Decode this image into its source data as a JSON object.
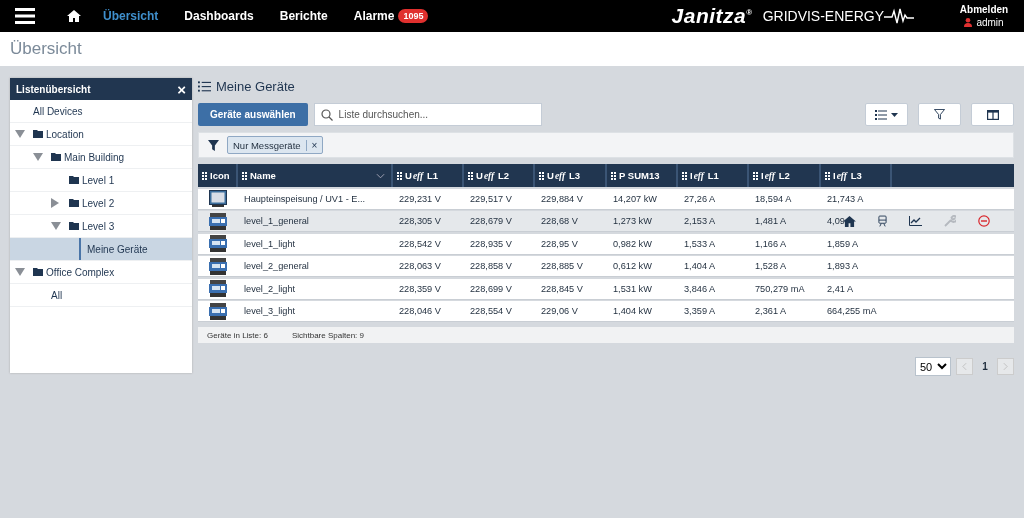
{
  "nav": {
    "tabs": [
      {
        "label": "Übersicht",
        "selected": true
      },
      {
        "label": "Dashboards",
        "selected": false
      },
      {
        "label": "Berichte",
        "selected": false
      },
      {
        "label": "Alarme",
        "selected": false,
        "badge": "1095"
      }
    ],
    "logo": "Janitza",
    "logo_mark": "®",
    "product": "GRIDVIS-ENERGY",
    "logout": "Abmelden",
    "user": "admin"
  },
  "page_title": "Übersicht",
  "sidebar": {
    "title": "Listenübersicht",
    "close": "×",
    "items": [
      {
        "label": "All Devices",
        "kind": "list",
        "selected": false
      },
      {
        "label": "Location",
        "kind": "folder",
        "expanded": true,
        "selected": false,
        "children": [
          {
            "label": "Main Building",
            "kind": "folder",
            "expanded": true,
            "selected": false,
            "children": [
              {
                "label": "Level 1",
                "kind": "folder",
                "selected": false
              },
              {
                "label": "Level 2",
                "kind": "folder",
                "expanded": false,
                "selected": false
              },
              {
                "label": "Level 3",
                "kind": "folder",
                "expanded": true,
                "selected": false,
                "children": [
                  {
                    "label": "Meine Geräte",
                    "kind": "list",
                    "selected": true
                  }
                ]
              }
            ]
          }
        ]
      },
      {
        "label": "Office Complex",
        "kind": "folder",
        "expanded": true,
        "selected": false,
        "children": [
          {
            "label": "All",
            "kind": "list",
            "selected": false
          }
        ]
      }
    ]
  },
  "main": {
    "title": "Meine Geräte",
    "select_button": "Geräte auswählen",
    "search": {
      "placeholder": "Liste durchsuchen..."
    },
    "filter_tag": {
      "label": "Nur Messgeräte",
      "remove": "×"
    },
    "table": {
      "icon_header": "Icon",
      "columns": [
        {
          "prefix": "Name"
        },
        {
          "prefix": "U",
          "italic": "eff",
          "suffix": " L1"
        },
        {
          "prefix": "U",
          "italic": "eff",
          "suffix": " L2"
        },
        {
          "prefix": "U",
          "italic": "eff",
          "suffix": " L3"
        },
        {
          "prefix": "P SUM13"
        },
        {
          "prefix": "I",
          "italic": "eff",
          "suffix": " L1"
        },
        {
          "prefix": "I",
          "italic": "eff",
          "suffix": " L2"
        },
        {
          "prefix": "I",
          "italic": "eff",
          "suffix": " L3"
        }
      ],
      "rows": [
        {
          "kind": "display",
          "hovered": false,
          "cells": [
            "Haupteinspeisung / UV1 - E...",
            "229,231 V",
            "229,517 V",
            "229,884 V",
            "14,207 kW",
            "27,26 A",
            "18,594 A",
            "21,743 A"
          ]
        },
        {
          "kind": "module",
          "hovered": true,
          "cells": [
            "level_1_general",
            "228,305 V",
            "228,679 V",
            "228,68 V",
            "1,273 kW",
            "2,153 A",
            "1,481 A",
            "4,09"
          ]
        },
        {
          "kind": "module",
          "hovered": false,
          "cells": [
            "level_1_light",
            "228,542 V",
            "228,935 V",
            "228,95 V",
            "0,982 kW",
            "1,533 A",
            "1,166 A",
            "1,859 A"
          ]
        },
        {
          "kind": "module",
          "hovered": false,
          "cells": [
            "level_2_general",
            "228,063 V",
            "228,858 V",
            "228,885 V",
            "0,612 kW",
            "1,404 A",
            "1,528 A",
            "1,893 A"
          ]
        },
        {
          "kind": "module",
          "hovered": false,
          "cells": [
            "level_2_light",
            "228,359 V",
            "228,699 V",
            "228,845 V",
            "1,531 kW",
            "3,846 A",
            "750,279 mA",
            "2,41 A"
          ]
        },
        {
          "kind": "module",
          "hovered": false,
          "cells": [
            "level_3_light",
            "228,046 V",
            "228,554 V",
            "229,06 V",
            "1,404 kW",
            "3,359 A",
            "2,361 A",
            "664,255 mA"
          ]
        }
      ]
    },
    "footer": [
      {
        "label": "Geräte in Liste:",
        "value": "6"
      },
      {
        "label": "Sichtbare Spalten:",
        "value": "9"
      }
    ],
    "pagination": {
      "page_size": "50",
      "page": "1"
    }
  }
}
